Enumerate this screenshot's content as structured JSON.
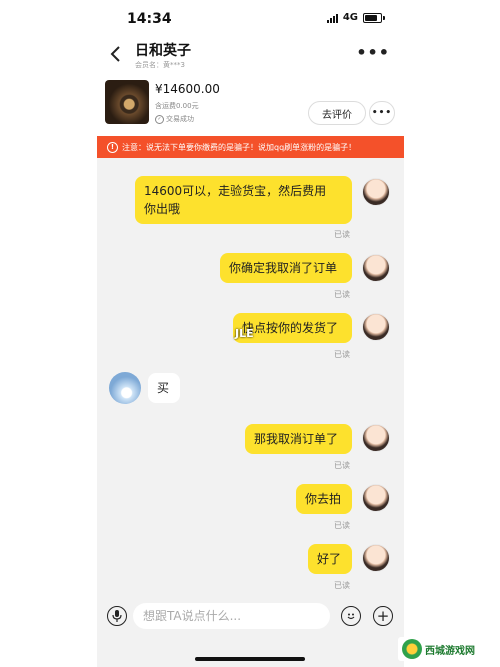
{
  "status_bar": {
    "time": "14:34",
    "network": "4G"
  },
  "header": {
    "title": "日和英子",
    "subtitle": "会员名：黄***3"
  },
  "product": {
    "price": "¥14600.00",
    "shipping": "含运费0.00元",
    "deal_status": "交易成功",
    "review_button": "去评价",
    "more_button": "•••"
  },
  "warning": {
    "text": "注意：说无法下单要你缴费的是骗子！说加qq刷单涨粉的是骗子！"
  },
  "messages": [
    {
      "side": "right",
      "text_line1": "14600可以，走验货宝，然后费用",
      "text_line2": "你出哦",
      "read": "已读"
    },
    {
      "side": "right",
      "text": "你确定我取消了订单",
      "read": "已读"
    },
    {
      "side": "right",
      "text": "快点按你的发货了",
      "read": "已读"
    },
    {
      "side": "left",
      "text": "买"
    },
    {
      "side": "right",
      "text": "那我取消订单了",
      "read": "已读"
    },
    {
      "side": "right",
      "text": "你去拍",
      "read": "已读"
    },
    {
      "side": "right",
      "text": "好了",
      "read": "已读"
    }
  ],
  "overlay": "JLE",
  "input": {
    "placeholder": "想跟TA说点什么..."
  },
  "watermark": {
    "text": "西城游戏网"
  },
  "colors": {
    "bubble_self": "#fde12d",
    "warning_bg": "#f4512a",
    "bg": "#f2f2f2"
  }
}
